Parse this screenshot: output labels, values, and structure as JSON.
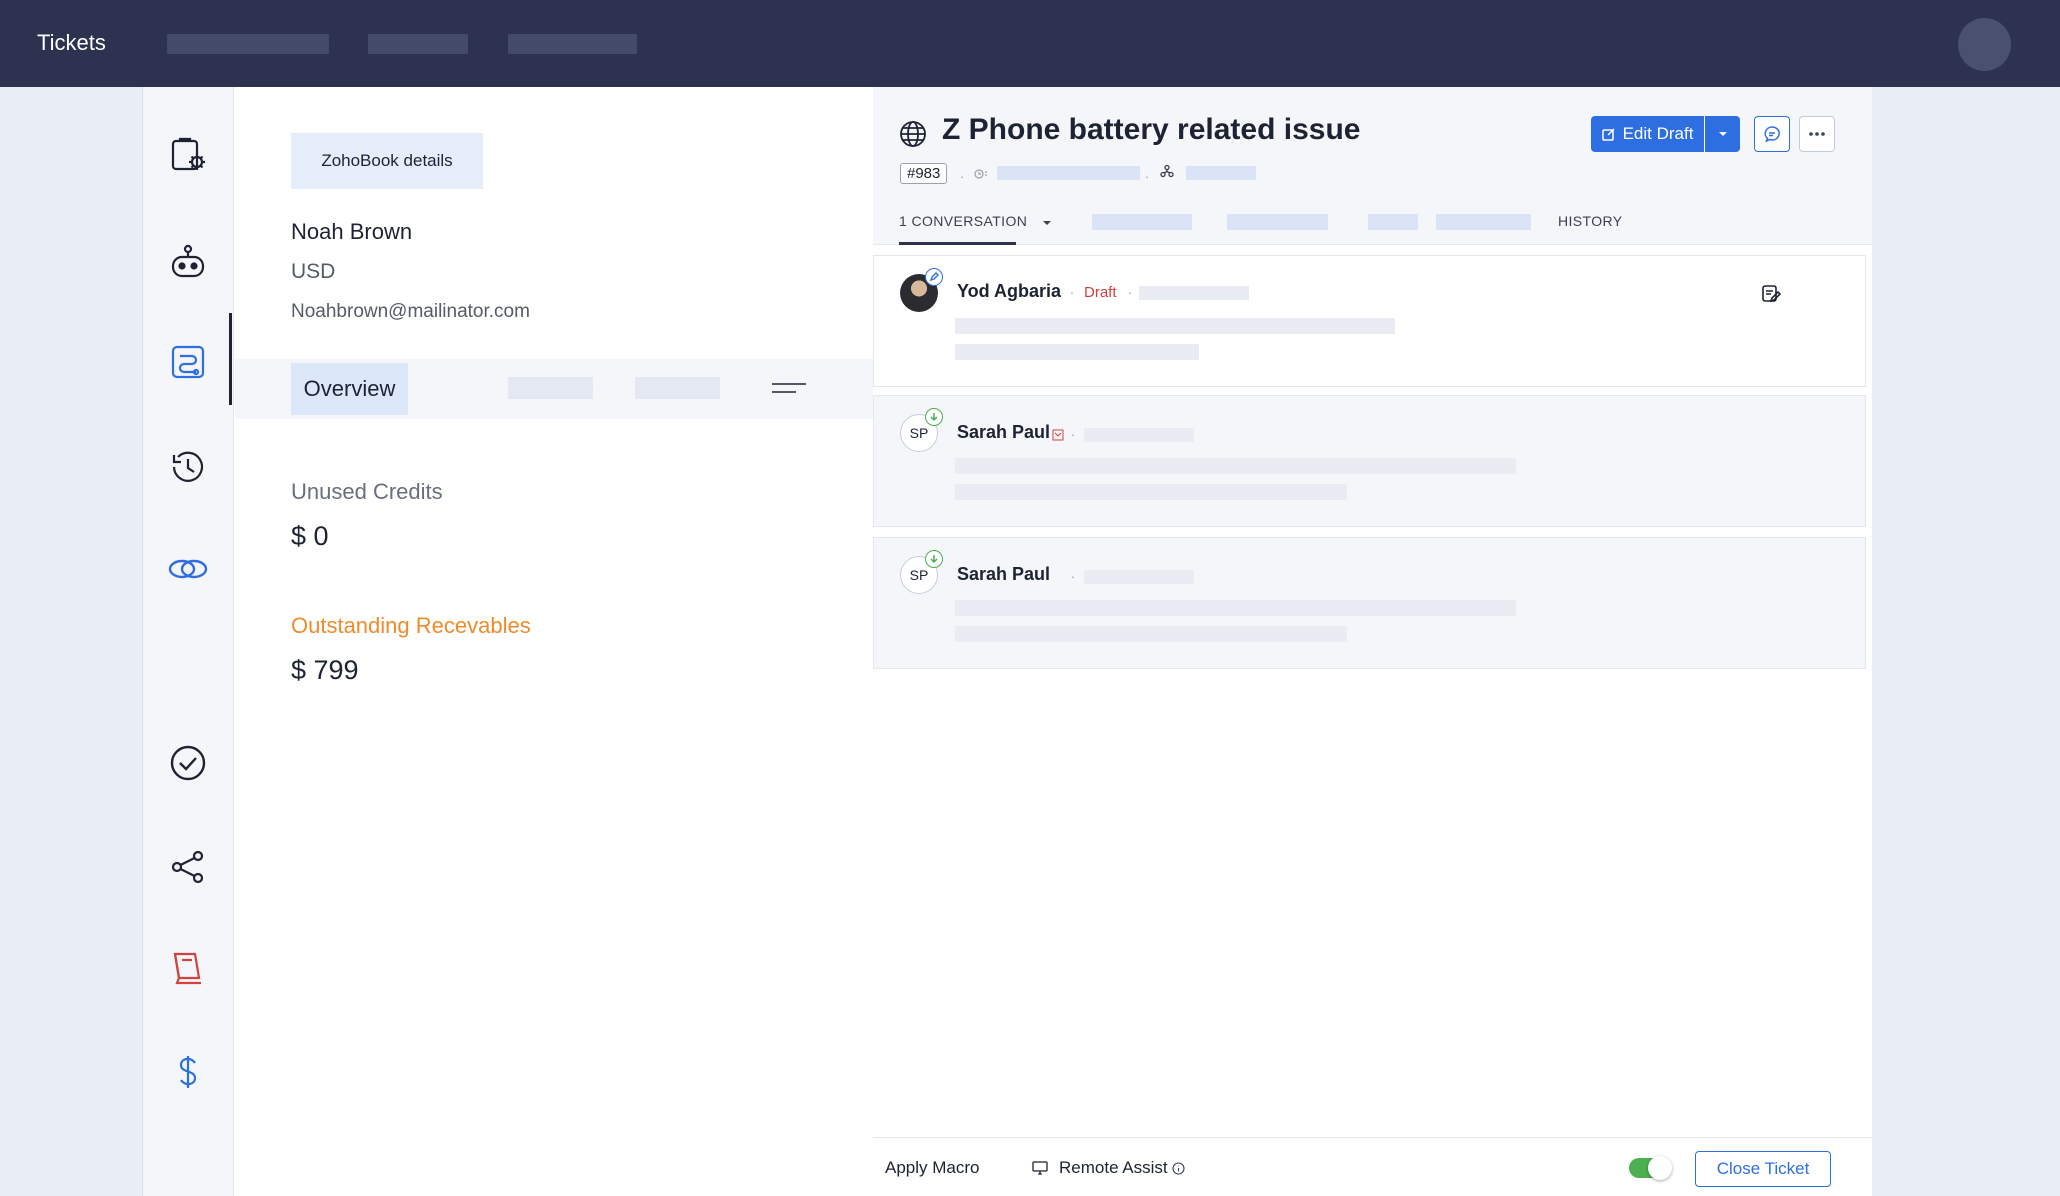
{
  "app": {
    "title": "Tickets"
  },
  "rail": {
    "icons": [
      "clipboard-gear-icon",
      "bot-icon",
      "blueprint-icon",
      "history-icon",
      "zoho-link-icon",
      "check-circle-icon",
      "share-icon",
      "book-icon",
      "dollar-icon"
    ],
    "active": "blueprint-icon"
  },
  "customer": {
    "chip": "ZohoBook details",
    "name": "Noah Brown",
    "currency": "USD",
    "email": "Noahbrown@mailinator.com",
    "active_tab": "Overview",
    "unused_credits_label": "Unused Credits",
    "unused_credits_value": "$ 0",
    "outstanding_label": "Outstanding Recevables",
    "outstanding_value": "$ 799"
  },
  "ticket": {
    "title": "Z Phone battery related issue",
    "id": "#983",
    "edit_label": "Edit Draft",
    "tabs": {
      "conversation": "1 CONVERSATION",
      "history": "HISTORY"
    }
  },
  "conversations": [
    {
      "sender": "Yod Agbaria",
      "status": "Draft",
      "initials": ""
    },
    {
      "sender": "Sarah Paul",
      "status": "",
      "initials": "SP"
    },
    {
      "sender": "Sarah Paul",
      "status": "",
      "initials": "SP"
    }
  ],
  "footer": {
    "apply_macro": "Apply Macro",
    "remote_assist": "Remote Assist",
    "close_ticket": "Close Ticket",
    "toggle_on": true
  },
  "colors": {
    "topbar": "#2d3250",
    "accent": "#2d6fe0",
    "orange": "#f08b2c",
    "draft": "#d2423e",
    "toggle": "#4caf50"
  }
}
